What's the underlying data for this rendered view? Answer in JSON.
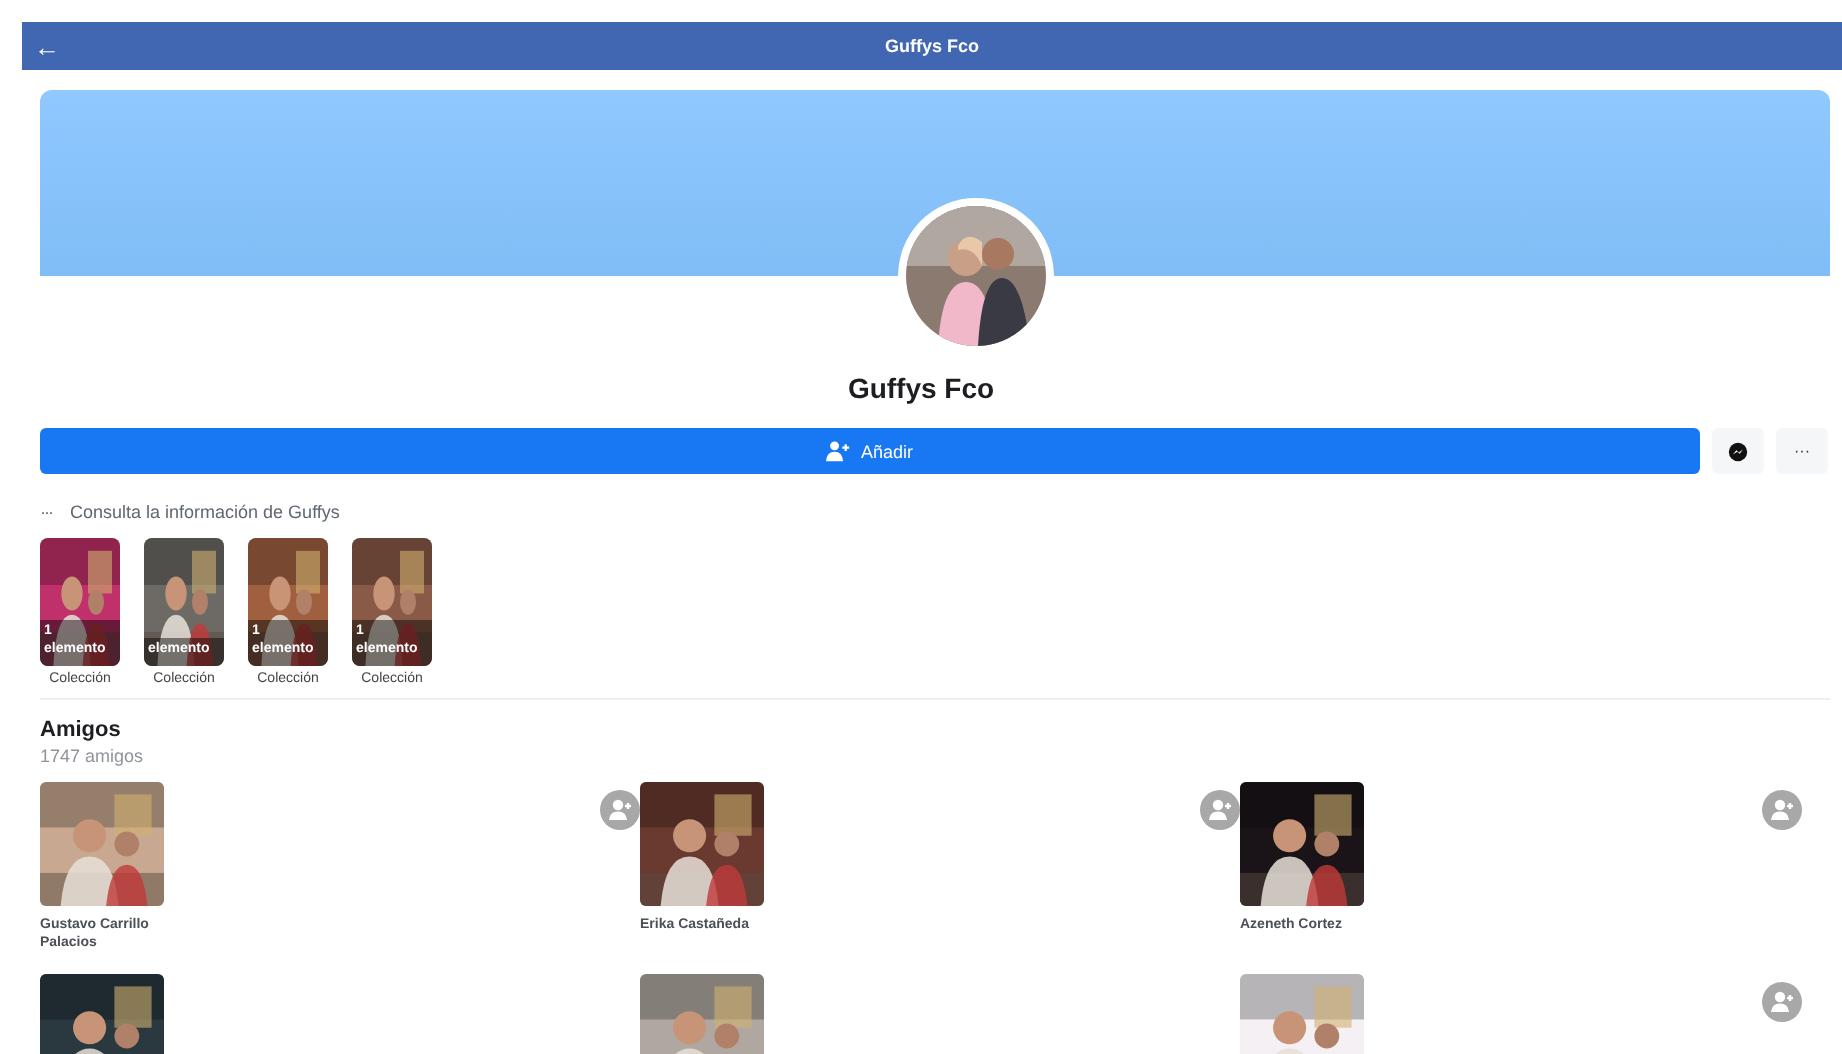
{
  "top_bar": {
    "back": "←",
    "title": "Guffys Fco"
  },
  "profile": {
    "name": "Guffys Fco"
  },
  "actions": {
    "add_label": "Añadir",
    "more": "···"
  },
  "info": {
    "more": "···",
    "text": "Consulta la información de Guffys"
  },
  "highlights": [
    {
      "count": "1",
      "unit": "elemento",
      "label": "Colección"
    },
    {
      "unit": "elemento",
      "label": "Colección"
    },
    {
      "count": "1",
      "unit": "elemento",
      "label": "Colección"
    },
    {
      "count": "1",
      "unit": "elemento",
      "label": "Colección"
    }
  ],
  "friends": {
    "title": "Amigos",
    "count": "1747 amigos",
    "items": [
      {
        "name": "Gustavo Carrillo Palacios",
        "add_button": true
      },
      {
        "name": "Erika Castañeda",
        "add_button": true
      },
      {
        "name": "Azeneth Cortez",
        "add_button": true
      },
      {
        "add_button": false
      },
      {
        "add_button": false
      },
      {
        "add_button": true
      }
    ]
  }
}
